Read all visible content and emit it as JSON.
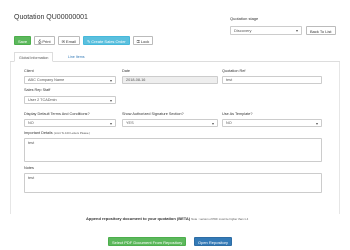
{
  "page": {
    "title": "Quotation QU00000001"
  },
  "toolbar": {
    "save_label": "Save",
    "print_label": "Print",
    "email_label": "Email",
    "create_order_label": "Create Sales Order",
    "lock_label": "Lock"
  },
  "stage": {
    "label": "Quotation stage",
    "value": "Discovery",
    "back_label": "Back To List"
  },
  "tabs": [
    {
      "label": "Global Information"
    },
    {
      "label": "Line Items"
    }
  ],
  "form": {
    "client": {
      "label": "Client",
      "value": "ABC Company Name"
    },
    "date": {
      "label": "Date",
      "value": "2018-08-16"
    },
    "quotation_ref": {
      "label": "Quotation Ref",
      "value": "test"
    },
    "sales_rep": {
      "label": "Sales Rep Staff",
      "value": "User 2 TCADmin"
    },
    "display_terms": {
      "label": "Display Default Terms And Conditions?",
      "value": "NO"
    },
    "show_signature": {
      "label": "Show Authorized Signature Section?",
      "value": "YES"
    },
    "use_template": {
      "label": "Use As Template?",
      "value": "NO"
    },
    "important_details": {
      "label": "Important Details",
      "hint": "(Limit To 100 Letters Please.)",
      "value": "test"
    },
    "notes": {
      "label": "Notes",
      "value": "test"
    }
  },
  "append": {
    "text": "Append repository document to your quotation (BETA)",
    "note": "Note : version of PDF must be higher than 1.4",
    "select_label": "Select PDF Document From Repository",
    "open_label": "Open Repository"
  },
  "colors": {
    "green": "#5cb85c",
    "info": "#5bc0de",
    "blue": "#337ab7"
  }
}
